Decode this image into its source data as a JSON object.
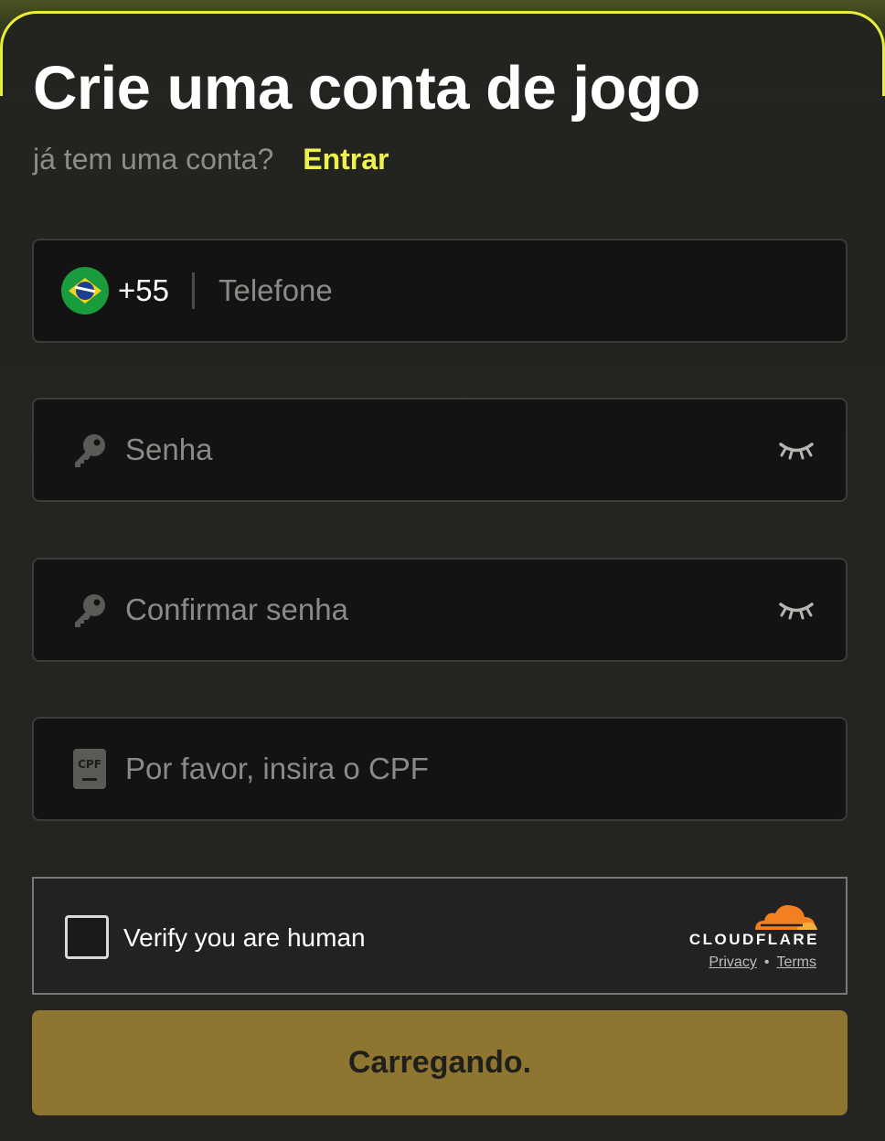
{
  "header": {
    "title": "Crie uma conta de jogo",
    "subtitle": "já tem uma conta?",
    "login_link": "Entrar"
  },
  "phone_field": {
    "country_flag": "brazil-flag-icon",
    "dial_code": "+55",
    "placeholder": "Telefone"
  },
  "password_field": {
    "icon": "key-icon",
    "placeholder": "Senha",
    "toggle_icon": "eye-closed-icon"
  },
  "confirm_password_field": {
    "icon": "key-icon",
    "placeholder": "Confirmar senha",
    "toggle_icon": "eye-closed-icon"
  },
  "cpf_field": {
    "icon": "cpf-card-icon",
    "icon_text": "CPF",
    "placeholder": "Por favor, insira o CPF"
  },
  "captcha": {
    "label": "Verify you are human",
    "brand": "CLOUDFLARE",
    "privacy": "Privacy",
    "separator": "•",
    "terms": "Terms",
    "brand_color": "#f38020"
  },
  "submit": {
    "label": "Carregando."
  },
  "colors": {
    "accent": "#eef24a",
    "button": "#8e7530",
    "field_bg": "#131313",
    "card_bg": "#232320"
  }
}
